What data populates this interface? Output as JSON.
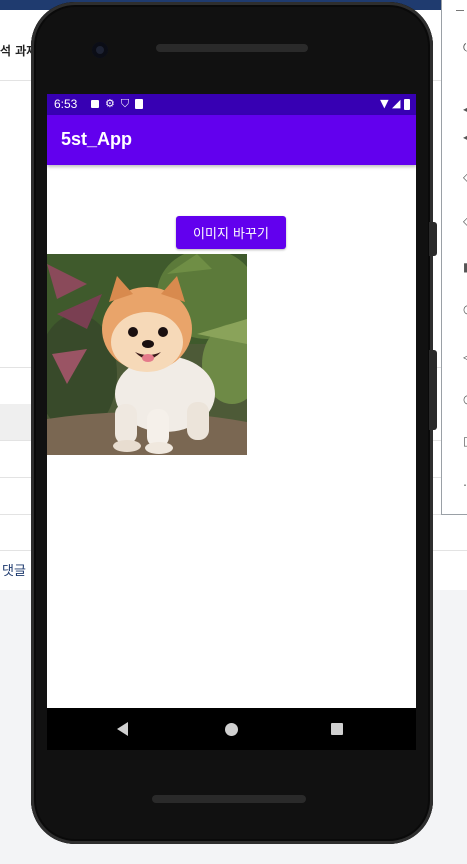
{
  "background_page": {
    "title_fragment": "석 과제",
    "comment_fragment": "댓글"
  },
  "status_bar": {
    "time": "6:53"
  },
  "app": {
    "title": "5st_App",
    "change_image_button": "이미지 바꾸기"
  },
  "colors": {
    "status_bar": "#3700b3",
    "app_bar": "#6200ee",
    "button": "#6200ee"
  },
  "icons": {
    "status_left": [
      "a-icon",
      "gear-icon",
      "shield-icon",
      "sd-card-icon"
    ],
    "status_right": [
      "wifi-icon",
      "signal-icon",
      "battery-icon"
    ],
    "nav": [
      "back-icon",
      "home-icon",
      "recents-icon"
    ]
  },
  "image": {
    "subject": "pomeranian dog photo"
  }
}
